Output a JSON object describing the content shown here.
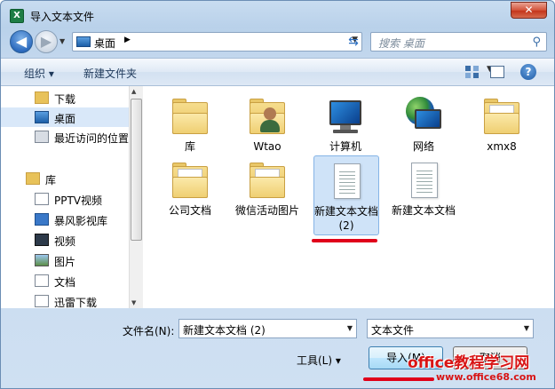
{
  "window": {
    "title": "导入文本文件",
    "close_label": "✕"
  },
  "nav": {
    "address_label": "桌面",
    "search_placeholder": "搜索 桌面"
  },
  "toolbar": {
    "organize_label": "组织 ▾",
    "new_folder_label": "新建文件夹"
  },
  "sidebar": {
    "items": [
      {
        "label": "下载",
        "icon": "download-folder-icon"
      },
      {
        "label": "桌面",
        "icon": "desktop-icon",
        "selected": true
      },
      {
        "label": "最近访问的位置",
        "icon": "recent-places-icon"
      },
      {
        "label": "库",
        "icon": "library-icon"
      },
      {
        "label": "PPTV视频",
        "icon": "pptv-icon"
      },
      {
        "label": "暴风影视库",
        "icon": "video-library-icon"
      },
      {
        "label": "视频",
        "icon": "videos-icon"
      },
      {
        "label": "图片",
        "icon": "pictures-icon"
      },
      {
        "label": "文档",
        "icon": "documents-icon"
      },
      {
        "label": "迅雷下载",
        "icon": "thunder-download-icon"
      }
    ]
  },
  "files": [
    {
      "name": "库",
      "icon": "library-folder-icon"
    },
    {
      "name": "Wtao",
      "icon": "user-folder-icon"
    },
    {
      "name": "计算机",
      "icon": "computer-icon"
    },
    {
      "name": "网络",
      "icon": "network-icon"
    },
    {
      "name": "xmx8",
      "icon": "folder-icon"
    },
    {
      "name": "公司文档",
      "icon": "folder-icon"
    },
    {
      "name": "微信活动图片",
      "icon": "folder-icon"
    },
    {
      "name": "新建文本文档 (2)",
      "icon": "text-document-icon",
      "selected": true
    },
    {
      "name": "新建文本文档",
      "icon": "text-document-icon"
    }
  ],
  "footer": {
    "filename_label": "文件名(N):",
    "filename_value": "新建文本文档 (2)",
    "filetype_value": "文本文件",
    "tools_label": "工具(L) ▾",
    "import_label": "导入(M)",
    "cancel_label": "取消"
  },
  "watermark": {
    "text": "office教程学习网",
    "url": "www.office68.com"
  },
  "colors": {
    "accent": "#2e6cbf",
    "selection": "#cfe3f8",
    "annotation_red": "#e0001a"
  }
}
